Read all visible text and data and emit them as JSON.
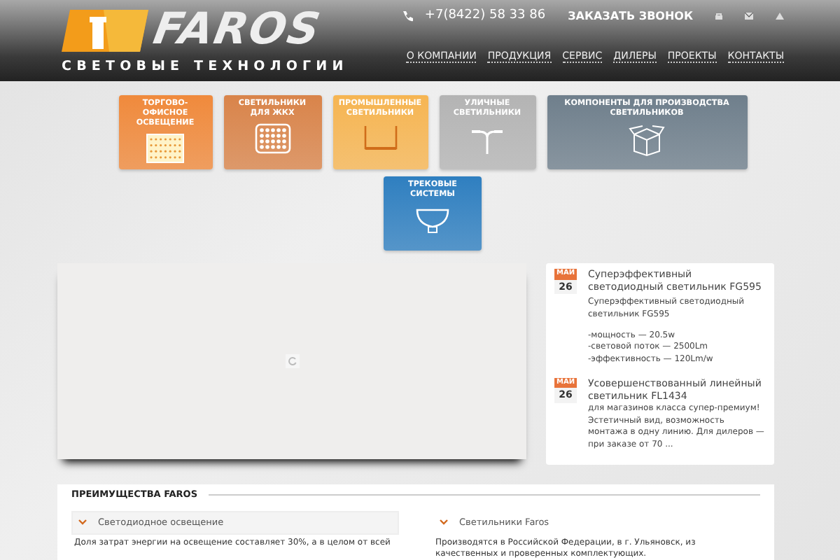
{
  "header": {
    "logo": {
      "name": "FAROS",
      "tagline": "СВЕТОВЫЕ ТЕХНОЛОГИИ"
    },
    "phone": "+7(8422) 58 33 86",
    "callback": "ЗАКАЗАТЬ ЗВОНОК",
    "nav": [
      {
        "label": "О КОМПАНИИ"
      },
      {
        "label": "ПРОДУКЦИЯ"
      },
      {
        "label": "СЕРВИС"
      },
      {
        "label": "ДИЛЕРЫ"
      },
      {
        "label": "ПРОЕКТЫ"
      },
      {
        "label": "КОНТАКТЫ"
      }
    ]
  },
  "categories": [
    {
      "label": "ТОРГОВО-ОФИСНОЕ ОСВЕЩЕНИЕ",
      "kind": "panel",
      "color": "#f08a3c"
    },
    {
      "label": "СВЕТИЛЬНИКИ ДЛЯ ЖКХ",
      "kind": "grid",
      "color": "#d9844a"
    },
    {
      "label": "ПРОМЫШЛЕННЫЕ СВЕТИЛЬНИКИ",
      "kind": "industrial",
      "color": "#f6b552"
    },
    {
      "label": "УЛИЧНЫЕ СВЕТИЛЬНИКИ",
      "kind": "street",
      "color": "#b4b4b4"
    },
    {
      "label": "КОМПОНЕНТЫ ДЛЯ ПРОИЗВОДСТВА СВЕТИЛЬНИКОВ",
      "kind": "box",
      "color": "#6f7f8c"
    },
    {
      "label": "ТРЕКОВЫЕ СИСТЕМЫ",
      "kind": "track",
      "color": "#2f7fc0"
    }
  ],
  "news": [
    {
      "month": "МАЙ",
      "day": "26",
      "title": "Суперэффективный светодиодный светильник FG595",
      "text": [
        "Суперэффективный светодиодный светильник FG595",
        "-мощность — 20.5w",
        "-световой поток — 2500Lm",
        "-эффективность — 120Lm/w"
      ]
    },
    {
      "month": "МАЙ",
      "day": "26",
      "title": "Усовершенствованный линейный светильник FL1434",
      "text": [
        "для магазинов класса супер-премиум! Эстетичный вид, возможность монтажа в одну линию. Для дилеров — при заказе от 70 ..."
      ]
    }
  ],
  "advantages": {
    "title": "ПРЕИМУЩЕСТВА FAROS",
    "items": [
      {
        "title": "Светодиодное освещение",
        "expanded": true,
        "text": "Доля затрат энергии на освещение составляет 30%, а в целом от всей"
      },
      {
        "title": "Светильники Faros",
        "expanded": true,
        "text": "Производятся в Российской Федерации, в г. Ульяновск, из качественных и проверенных комплектующих."
      }
    ]
  }
}
